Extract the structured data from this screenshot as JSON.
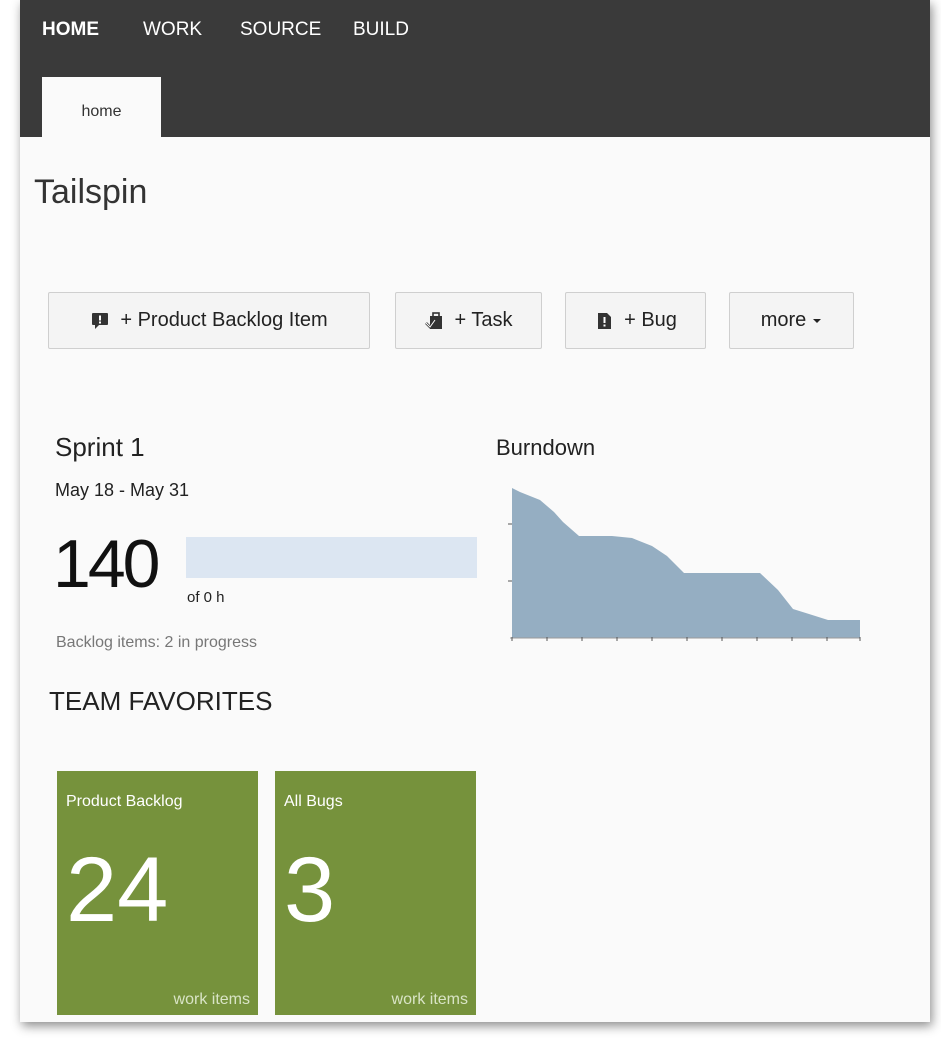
{
  "nav": {
    "items": [
      {
        "label": "HOME",
        "active": true
      },
      {
        "label": "WORK",
        "active": false
      },
      {
        "label": "SOURCE",
        "active": false
      },
      {
        "label": "BUILD",
        "active": false
      }
    ],
    "tab_label": "home"
  },
  "project_title": "Tailspin",
  "quick_add": {
    "pbi_label": "+ Product Backlog Item",
    "task_label": "+ Task",
    "bug_label": "+ Bug",
    "more_label": "more"
  },
  "sprint": {
    "title": "Sprint 1",
    "dates": "May 18 - May 31",
    "remaining": "140",
    "capacity_text": "of 0 h",
    "backlog_status": "Backlog items: 2 in progress",
    "progress_fraction": 1.0
  },
  "burndown": {
    "title": "Burndown",
    "color": "#8faabf"
  },
  "team_favorites": {
    "heading": "TEAM FAVORITES",
    "tiles": [
      {
        "name": "Product Backlog",
        "count": "24",
        "unit": "work items"
      },
      {
        "name": "All Bugs",
        "count": "3",
        "unit": "work items"
      }
    ]
  },
  "colors": {
    "topbar": "#3a3a3a",
    "tile_green": "#76923c",
    "progress_bar": "#dce6f2"
  }
}
